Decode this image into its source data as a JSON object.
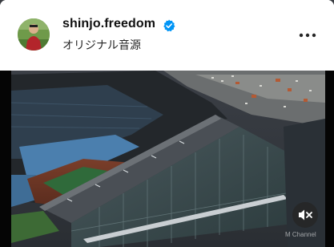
{
  "post": {
    "username": "shinjo.freedom",
    "audio_label": "オリジナル音源"
  },
  "icons": {
    "verified": "verified-badge-icon",
    "more": "more-options-icon",
    "mute": "muted-speaker-icon"
  },
  "media": {
    "watermark": "M Channel"
  },
  "colors": {
    "verified_blue": "#0095f6",
    "text_primary": "#111111"
  }
}
